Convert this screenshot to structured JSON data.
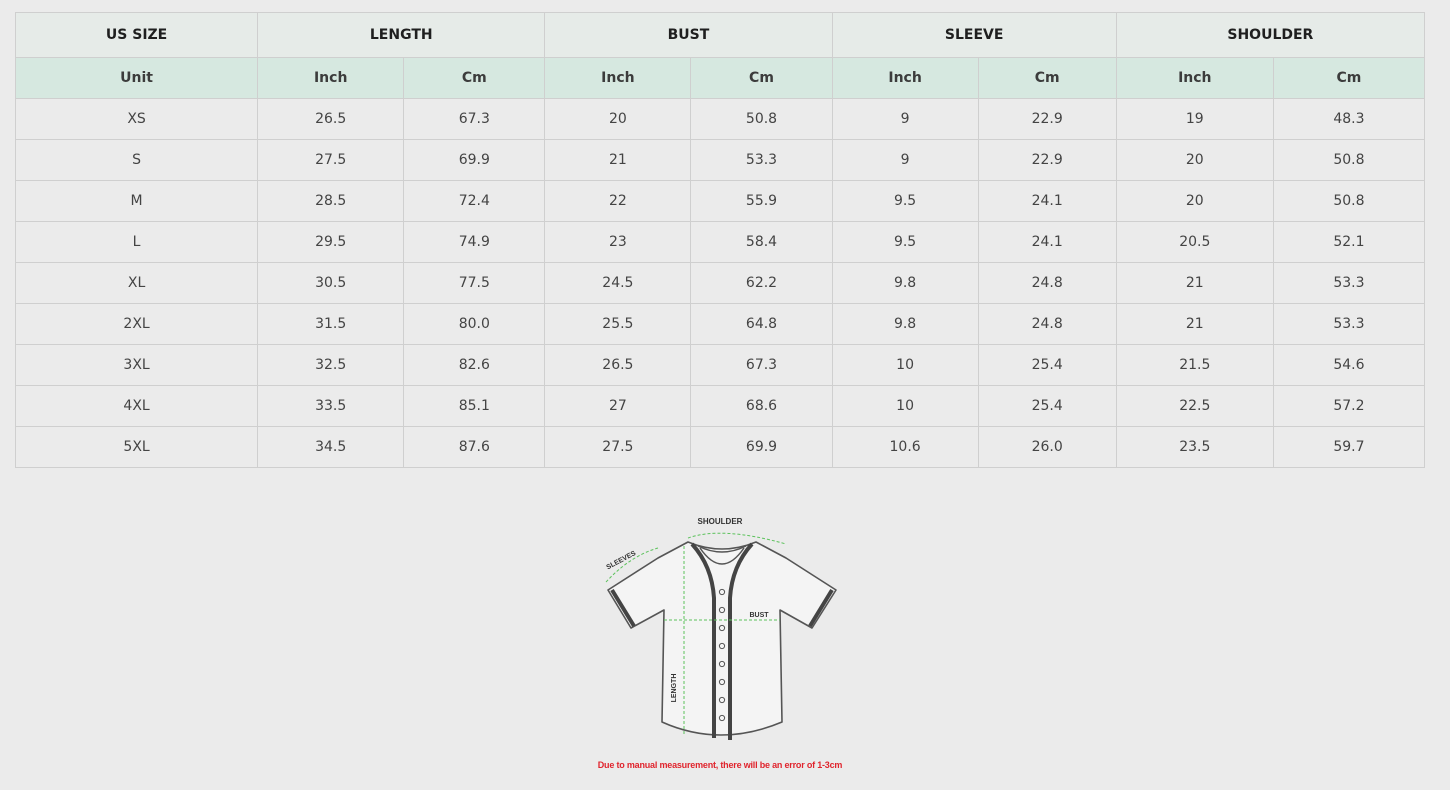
{
  "table": {
    "groups": {
      "us_size": "US SIZE",
      "length": "LENGTH",
      "bust": "BUST",
      "sleeve": "SLEEVE",
      "shoulder": "SHOULDER"
    },
    "units": {
      "unit": "Unit",
      "inch": "Inch",
      "cm": "Cm"
    },
    "rows": [
      {
        "size": "XS",
        "length_in": "26.5",
        "length_cm": "67.3",
        "bust_in": "20",
        "bust_cm": "50.8",
        "sleeve_in": "9",
        "sleeve_cm": "22.9",
        "shoulder_in": "19",
        "shoulder_cm": "48.3"
      },
      {
        "size": "S",
        "length_in": "27.5",
        "length_cm": "69.9",
        "bust_in": "21",
        "bust_cm": "53.3",
        "sleeve_in": "9",
        "sleeve_cm": "22.9",
        "shoulder_in": "20",
        "shoulder_cm": "50.8"
      },
      {
        "size": "M",
        "length_in": "28.5",
        "length_cm": "72.4",
        "bust_in": "22",
        "bust_cm": "55.9",
        "sleeve_in": "9.5",
        "sleeve_cm": "24.1",
        "shoulder_in": "20",
        "shoulder_cm": "50.8"
      },
      {
        "size": "L",
        "length_in": "29.5",
        "length_cm": "74.9",
        "bust_in": "23",
        "bust_cm": "58.4",
        "sleeve_in": "9.5",
        "sleeve_cm": "24.1",
        "shoulder_in": "20.5",
        "shoulder_cm": "52.1"
      },
      {
        "size": "XL",
        "length_in": "30.5",
        "length_cm": "77.5",
        "bust_in": "24.5",
        "bust_cm": "62.2",
        "sleeve_in": "9.8",
        "sleeve_cm": "24.8",
        "shoulder_in": "21",
        "shoulder_cm": "53.3"
      },
      {
        "size": "2XL",
        "length_in": "31.5",
        "length_cm": "80.0",
        "bust_in": "25.5",
        "bust_cm": "64.8",
        "sleeve_in": "9.8",
        "sleeve_cm": "24.8",
        "shoulder_in": "21",
        "shoulder_cm": "53.3"
      },
      {
        "size": "3XL",
        "length_in": "32.5",
        "length_cm": "82.6",
        "bust_in": "26.5",
        "bust_cm": "67.3",
        "sleeve_in": "10",
        "sleeve_cm": "25.4",
        "shoulder_in": "21.5",
        "shoulder_cm": "54.6"
      },
      {
        "size": "4XL",
        "length_in": "33.5",
        "length_cm": "85.1",
        "bust_in": "27",
        "bust_cm": "68.6",
        "sleeve_in": "10",
        "sleeve_cm": "25.4",
        "shoulder_in": "22.5",
        "shoulder_cm": "57.2"
      },
      {
        "size": "5XL",
        "length_in": "34.5",
        "length_cm": "87.6",
        "bust_in": "27.5",
        "bust_cm": "69.9",
        "sleeve_in": "10.6",
        "sleeve_cm": "26.0",
        "shoulder_in": "23.5",
        "shoulder_cm": "59.7"
      }
    ]
  },
  "diagram": {
    "shoulder_label": "SHOULDER",
    "sleeves_label": "SLEEVES",
    "bust_label": "BUST",
    "length_label": "LENGTH",
    "measure_color": "#5cc25c"
  },
  "note": "Due to manual measurement, there will be an error of 1-3cm",
  "colors": {
    "header_group_bg": "#e6ebe8",
    "header_unit_bg": "#d6e8e0",
    "note_text": "#e0242d"
  }
}
